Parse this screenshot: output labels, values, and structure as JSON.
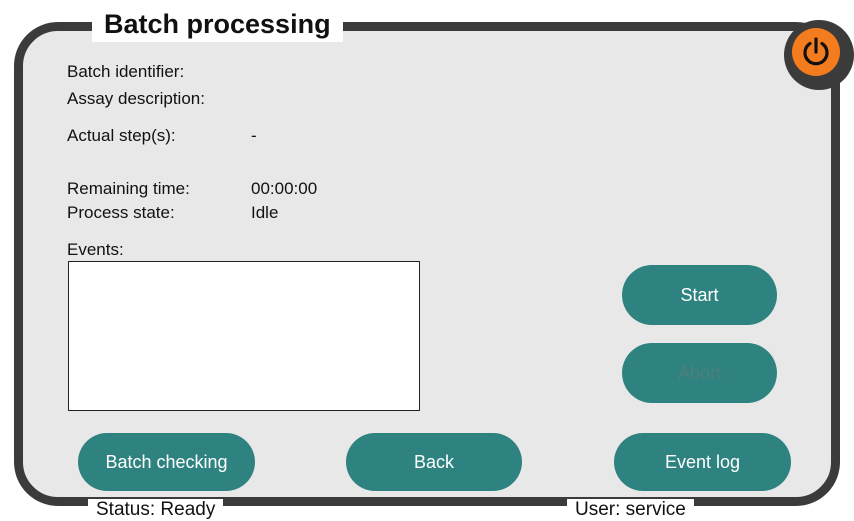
{
  "window": {
    "title": "Batch processing"
  },
  "fields": {
    "batch_identifier_label": "Batch identifier:",
    "assay_description_label": "Assay description:",
    "actual_steps_label": "Actual step(s):",
    "actual_steps_value": "-",
    "remaining_time_label": "Remaining time:",
    "remaining_time_value": "00:00:00",
    "process_state_label": "Process state:",
    "process_state_value": "Idle",
    "events_label": "Events:"
  },
  "buttons": {
    "start": "Start",
    "abort": "Abort",
    "batch_checking": "Batch checking",
    "back": "Back",
    "event_log": "Event log"
  },
  "status_bar": {
    "status": "Status: Ready",
    "user": "User: service"
  },
  "icons": {
    "power": "power-icon"
  },
  "colors": {
    "accent": "#2e8380",
    "power": "#f37c1e",
    "frame": "#3b3b3b",
    "panel": "#e8e8e8"
  }
}
